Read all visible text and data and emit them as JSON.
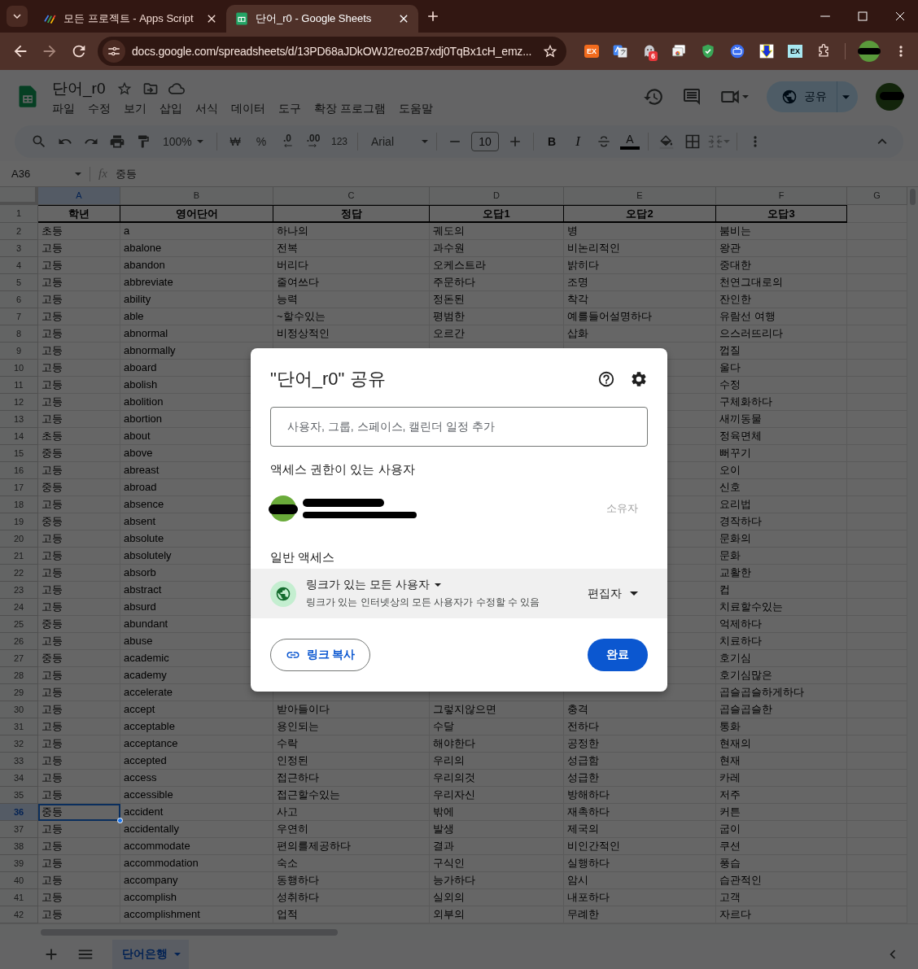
{
  "browser": {
    "tabs": [
      {
        "title": "모든 프로젝트 - Apps Script",
        "kind": "apps-script",
        "selected": false
      },
      {
        "title": "단어_r0 - Google Sheets",
        "kind": "sheets",
        "selected": true
      }
    ],
    "url": "docs.google.com/spreadsheets/d/13PD68aJDkOWJ2reo2B7xdj0TqBx1cH_emz...",
    "extensions": [
      {
        "kind": "ex-orange",
        "label": "EX"
      },
      {
        "kind": "translate"
      },
      {
        "kind": "ghost",
        "badge": "6"
      },
      {
        "kind": "windows"
      },
      {
        "kind": "shield"
      },
      {
        "kind": "stream"
      },
      {
        "kind": "download"
      },
      {
        "kind": "ex-box",
        "label": "EX"
      },
      {
        "kind": "puzzle"
      }
    ]
  },
  "sheets": {
    "title": "단어_r0",
    "menu": [
      "파일",
      "수정",
      "보기",
      "삽입",
      "서식",
      "데이터",
      "도구",
      "확장 프로그램",
      "도움말"
    ],
    "share_button": "공유",
    "toolbar": {
      "zoom": "100%",
      "currency": "₩",
      "percent": "%",
      "decimal_decrease": ".0",
      "decimal_increase": ".00",
      "number_format": "123",
      "font": "Arial",
      "font_size": "10",
      "bold": "B",
      "italic": "I",
      "text_color": "A"
    },
    "name_box": "A36",
    "formula_label": "fx",
    "formula": "중등",
    "sheet_tabs": [
      {
        "label": "단어은행",
        "selected": true
      }
    ]
  },
  "table": {
    "columns": [
      {
        "letter": "A",
        "selected": true
      },
      {
        "letter": "B",
        "selected": false
      },
      {
        "letter": "C",
        "selected": false
      },
      {
        "letter": "D",
        "selected": false
      },
      {
        "letter": "E",
        "selected": false
      },
      {
        "letter": "F",
        "selected": false
      },
      {
        "letter": "G",
        "selected": false
      }
    ],
    "header_row": {
      "number": "1",
      "grade": "학년",
      "word": "영어단어",
      "answer": "정답",
      "wrong_1": "오답1",
      "wrong_2": "오답2",
      "wrong_3": "오답3"
    },
    "rows": [
      {
        "number": "2",
        "selected": false,
        "grade": "초등",
        "word": "a",
        "answer": "하나의",
        "wrong_1": "궤도의",
        "wrong_2": "병",
        "wrong_3": "붐비는"
      },
      {
        "number": "3",
        "selected": false,
        "grade": "고등",
        "word": "abalone",
        "answer": "전복",
        "wrong_1": "과수원",
        "wrong_2": "비논리적인",
        "wrong_3": "왕관"
      },
      {
        "number": "4",
        "selected": false,
        "grade": "고등",
        "word": "abandon",
        "answer": "버리다",
        "wrong_1": "오케스트라",
        "wrong_2": "밝히다",
        "wrong_3": "중대한"
      },
      {
        "number": "5",
        "selected": false,
        "grade": "고등",
        "word": "abbreviate",
        "answer": "줄여쓰다",
        "wrong_1": "주문하다",
        "wrong_2": "조명",
        "wrong_3": "천연그대로의"
      },
      {
        "number": "6",
        "selected": false,
        "grade": "고등",
        "word": "ability",
        "answer": "능력",
        "wrong_1": "정돈된",
        "wrong_2": "착각",
        "wrong_3": "잔인한"
      },
      {
        "number": "7",
        "selected": false,
        "grade": "고등",
        "word": "able",
        "answer": "~할수있는",
        "wrong_1": "평범한",
        "wrong_2": "예를들어설명하다",
        "wrong_3": "유람선 여행"
      },
      {
        "number": "8",
        "selected": false,
        "grade": "고등",
        "word": "abnormal",
        "answer": "비정상적인",
        "wrong_1": "오르간",
        "wrong_2": "삽화",
        "wrong_3": "으스러뜨리다"
      },
      {
        "number": "9",
        "selected": false,
        "grade": "고등",
        "word": "abnormally",
        "wrong_3": "껍질"
      },
      {
        "number": "10",
        "selected": false,
        "grade": "고등",
        "word": "aboard",
        "wrong_3": "울다"
      },
      {
        "number": "11",
        "selected": false,
        "grade": "고등",
        "word": "abolish",
        "wrong_3": "수정"
      },
      {
        "number": "12",
        "selected": false,
        "grade": "고등",
        "word": "abolition",
        "wrong_3": "구체화하다"
      },
      {
        "number": "13",
        "selected": false,
        "grade": "고등",
        "word": "abortion",
        "wrong_3": "새끼동물"
      },
      {
        "number": "14",
        "selected": false,
        "grade": "초등",
        "word": "about",
        "wrong_3": "정육면체"
      },
      {
        "number": "15",
        "selected": false,
        "grade": "중등",
        "word": "above",
        "wrong_3": "뻐꾸기"
      },
      {
        "number": "16",
        "selected": false,
        "grade": "고등",
        "word": "abreast",
        "wrong_3": "오이"
      },
      {
        "number": "17",
        "selected": false,
        "grade": "중등",
        "word": "abroad",
        "wrong_3": "신호"
      },
      {
        "number": "18",
        "selected": false,
        "grade": "고등",
        "word": "absence",
        "wrong_3": "요리법"
      },
      {
        "number": "19",
        "selected": false,
        "grade": "중등",
        "word": "absent",
        "wrong_3": "경작하다"
      },
      {
        "number": "20",
        "selected": false,
        "grade": "고등",
        "word": "absolute",
        "wrong_3": "문화의"
      },
      {
        "number": "21",
        "selected": false,
        "grade": "고등",
        "word": "absolutely",
        "wrong_3": "문화"
      },
      {
        "number": "22",
        "selected": false,
        "grade": "고등",
        "word": "absorb",
        "wrong_3": "교활한"
      },
      {
        "number": "23",
        "selected": false,
        "grade": "고등",
        "word": "abstract",
        "wrong_3": "컵"
      },
      {
        "number": "24",
        "selected": false,
        "grade": "고등",
        "word": "absurd",
        "wrong_3": "치료할수있는"
      },
      {
        "number": "25",
        "selected": false,
        "grade": "중등",
        "word": "abundant",
        "wrong_3": "억제하다"
      },
      {
        "number": "26",
        "selected": false,
        "grade": "고등",
        "word": "abuse",
        "wrong_3": "치료하다"
      },
      {
        "number": "27",
        "selected": false,
        "grade": "중등",
        "word": "academic",
        "wrong_3": "호기심"
      },
      {
        "number": "28",
        "selected": false,
        "grade": "고등",
        "word": "academy",
        "wrong_3": "호기심많은"
      },
      {
        "number": "29",
        "selected": false,
        "grade": "고등",
        "word": "accelerate",
        "wrong_3": "곱슬곱슬하게하다"
      },
      {
        "number": "30",
        "selected": false,
        "grade": "고등",
        "word": "accept",
        "answer": "받아들이다",
        "wrong_1": "그렇지않으면",
        "wrong_2": "충격",
        "wrong_3": "곱슬곱슬한"
      },
      {
        "number": "31",
        "selected": false,
        "grade": "고등",
        "word": "acceptable",
        "answer": "용인되는",
        "wrong_1": "수달",
        "wrong_2": "전하다",
        "wrong_3": "통화"
      },
      {
        "number": "32",
        "selected": false,
        "grade": "고등",
        "word": "acceptance",
        "answer": "수락",
        "wrong_1": "해야한다",
        "wrong_2": "공정한",
        "wrong_3": "현재의"
      },
      {
        "number": "33",
        "selected": false,
        "grade": "고등",
        "word": "accepted",
        "answer": "인정된",
        "wrong_1": "우리의",
        "wrong_2": "성급함",
        "wrong_3": "현재"
      },
      {
        "number": "34",
        "selected": false,
        "grade": "고등",
        "word": "access",
        "answer": "접근하다",
        "wrong_1": "우리의것",
        "wrong_2": "성급한",
        "wrong_3": "카레"
      },
      {
        "number": "35",
        "selected": false,
        "grade": "고등",
        "word": "accessible",
        "answer": "접근할수있는",
        "wrong_1": "우리자신",
        "wrong_2": "방해하다",
        "wrong_3": "저주"
      },
      {
        "number": "36",
        "selected": true,
        "grade": "중등",
        "word": "accident",
        "answer": "사고",
        "wrong_1": "밖에",
        "wrong_2": "재촉하다",
        "wrong_3": "커튼"
      },
      {
        "number": "37",
        "selected": false,
        "grade": "고등",
        "word": "accidentally",
        "answer": "우연히",
        "wrong_1": "발생",
        "wrong_2": "제국의",
        "wrong_3": "굽이"
      },
      {
        "number": "38",
        "selected": false,
        "grade": "고등",
        "word": "accommodate",
        "answer": "편의를제공하다",
        "wrong_1": "결과",
        "wrong_2": "비인간적인",
        "wrong_3": "쿠션"
      },
      {
        "number": "39",
        "selected": false,
        "grade": "고등",
        "word": "accommodation",
        "answer": "숙소",
        "wrong_1": "구식인",
        "wrong_2": "실행하다",
        "wrong_3": "풍습"
      },
      {
        "number": "40",
        "selected": false,
        "grade": "고등",
        "word": "accompany",
        "answer": "동행하다",
        "wrong_1": "능가하다",
        "wrong_2": "암시",
        "wrong_3": "습관적인"
      },
      {
        "number": "41",
        "selected": false,
        "grade": "고등",
        "word": "accomplish",
        "answer": "성취하다",
        "wrong_1": "실외의",
        "wrong_2": "내포하다",
        "wrong_3": "고객"
      },
      {
        "number": "42",
        "selected": false,
        "grade": "고등",
        "word": "accomplishment",
        "answer": "업적",
        "wrong_1": "외부의",
        "wrong_2": "무례한",
        "wrong_3": "자르다"
      }
    ]
  },
  "share_dialog": {
    "title": "\"단어_r0\" 공유",
    "search": {
      "placeholder": "사용자, 그룹, 스페이스, 캘린더 일정 추가"
    },
    "people_heading": "액세스 권한이 있는 사용자",
    "people": [
      {
        "role": "소유자"
      }
    ],
    "general_heading": "일반 액세스",
    "access": {
      "audience": "링크가 있는 모든 사용자",
      "description": "링크가 있는 인터넷상의 모든 사용자가 수정할 수 있음",
      "role": "편집자"
    },
    "copy_link_button": "링크 복사",
    "done_button": "완료"
  }
}
